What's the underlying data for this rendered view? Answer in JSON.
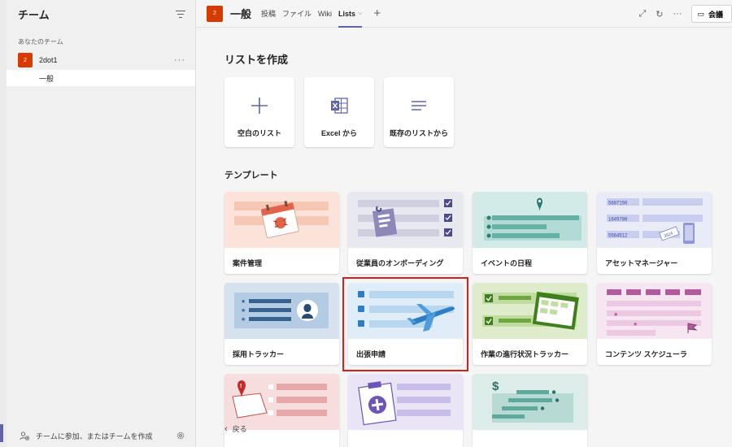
{
  "sidebar": {
    "title": "チーム",
    "section_label": "あなたのチーム",
    "team": {
      "avatar_initial": "2",
      "name": "2dot1",
      "more": "···"
    },
    "channel": {
      "name": "一般"
    },
    "footer": {
      "label": "チームに参加、またはチームを作成"
    }
  },
  "header": {
    "avatar_initial": "2",
    "channel_name": "一般",
    "tabs": [
      {
        "label": "投稿"
      },
      {
        "label": "ファイル"
      },
      {
        "label": "Wiki"
      },
      {
        "label": "Lists",
        "active": true
      }
    ],
    "meet_button_label": "会議"
  },
  "main": {
    "create_heading": "リストを作成",
    "create_options": [
      {
        "label": "空白のリスト",
        "icon": "plus-icon"
      },
      {
        "label": "Excel から",
        "icon": "excel-icon"
      },
      {
        "label": "既存のリストから",
        "icon": "lines-icon"
      }
    ],
    "templates_heading": "テンプレート",
    "templates": [
      {
        "label": "案件管理"
      },
      {
        "label": "従業員のオンボーディング"
      },
      {
        "label": "イベントの日程"
      },
      {
        "label": "アセットマネージャー"
      },
      {
        "label": "採用トラッカー"
      },
      {
        "label": "出張申請"
      },
      {
        "label": "作業の進行状況トラッカー"
      },
      {
        "label": "コンテンツ スケジューラ"
      },
      {
        "label": ""
      },
      {
        "label": ""
      },
      {
        "label": ""
      }
    ],
    "asset_numbers": [
      "5687156",
      "1649786",
      "5564512",
      "3524"
    ],
    "back_label": "戻る"
  },
  "colors": {
    "accent": "#6264a7",
    "avatar": "#d83b01",
    "highlight": "#d41f1f"
  }
}
